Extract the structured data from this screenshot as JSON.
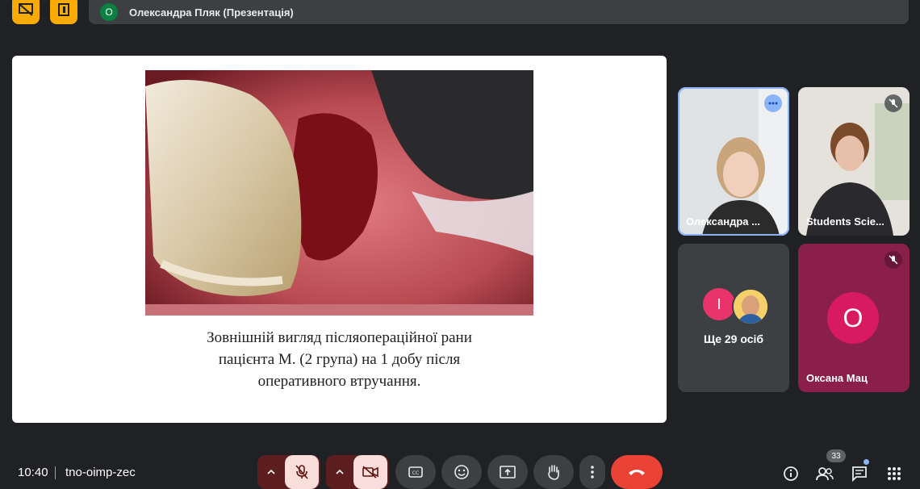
{
  "presenter": {
    "avatar_initial": "О",
    "label": "Олександра Пляк (Презентація)"
  },
  "slide": {
    "caption_lines": [
      "Зовнішній вигляд післяопераційної рани",
      "пацієнта М. (2 група) на 1 добу після",
      "оперативного втручання."
    ]
  },
  "participants": [
    {
      "name": "Олександра ...",
      "speaking": true,
      "muted": false
    },
    {
      "name": "Students Scie...",
      "muted": true
    },
    {
      "others_initial": "І",
      "others_label": "Ще 29 осіб"
    },
    {
      "name": "Оксана Мац",
      "initial": "О",
      "muted": true
    }
  ],
  "bottom": {
    "time": "10:40",
    "meeting_code": "tno-oimp-zec",
    "participant_count": "33"
  },
  "colors": {
    "accent_yellow": "#f9ab00",
    "leave_red": "#ea4335",
    "tile_pink": "#8a1f4a",
    "muted_pink": "#f9dedc"
  }
}
